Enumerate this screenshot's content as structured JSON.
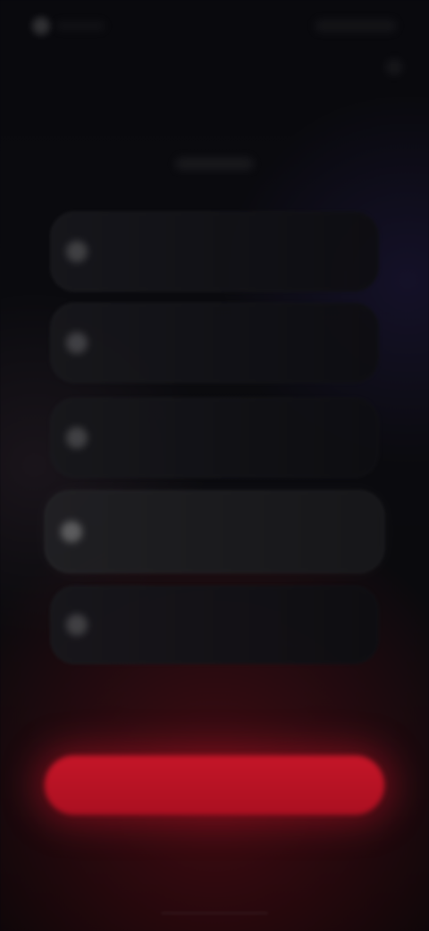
{
  "screen": {
    "title": "",
    "subtitle": "",
    "cta_label": "",
    "options": [
      {
        "title": "",
        "subtitle": "",
        "selected": false
      },
      {
        "title": "",
        "subtitle": "",
        "selected": false
      },
      {
        "title": "",
        "subtitle": "",
        "selected": false
      },
      {
        "title": "",
        "subtitle": "",
        "selected": true
      },
      {
        "title": "",
        "subtitle": "",
        "selected": false
      }
    ]
  },
  "colors": {
    "background": "#09090d",
    "card": "#17171b",
    "card_selected": "#222226",
    "accent_red": "#c41628"
  },
  "icons": {
    "status_left": "notification-dot-icon",
    "corner_top_right": "dismiss-icon",
    "radio": "radio-button-icon"
  }
}
